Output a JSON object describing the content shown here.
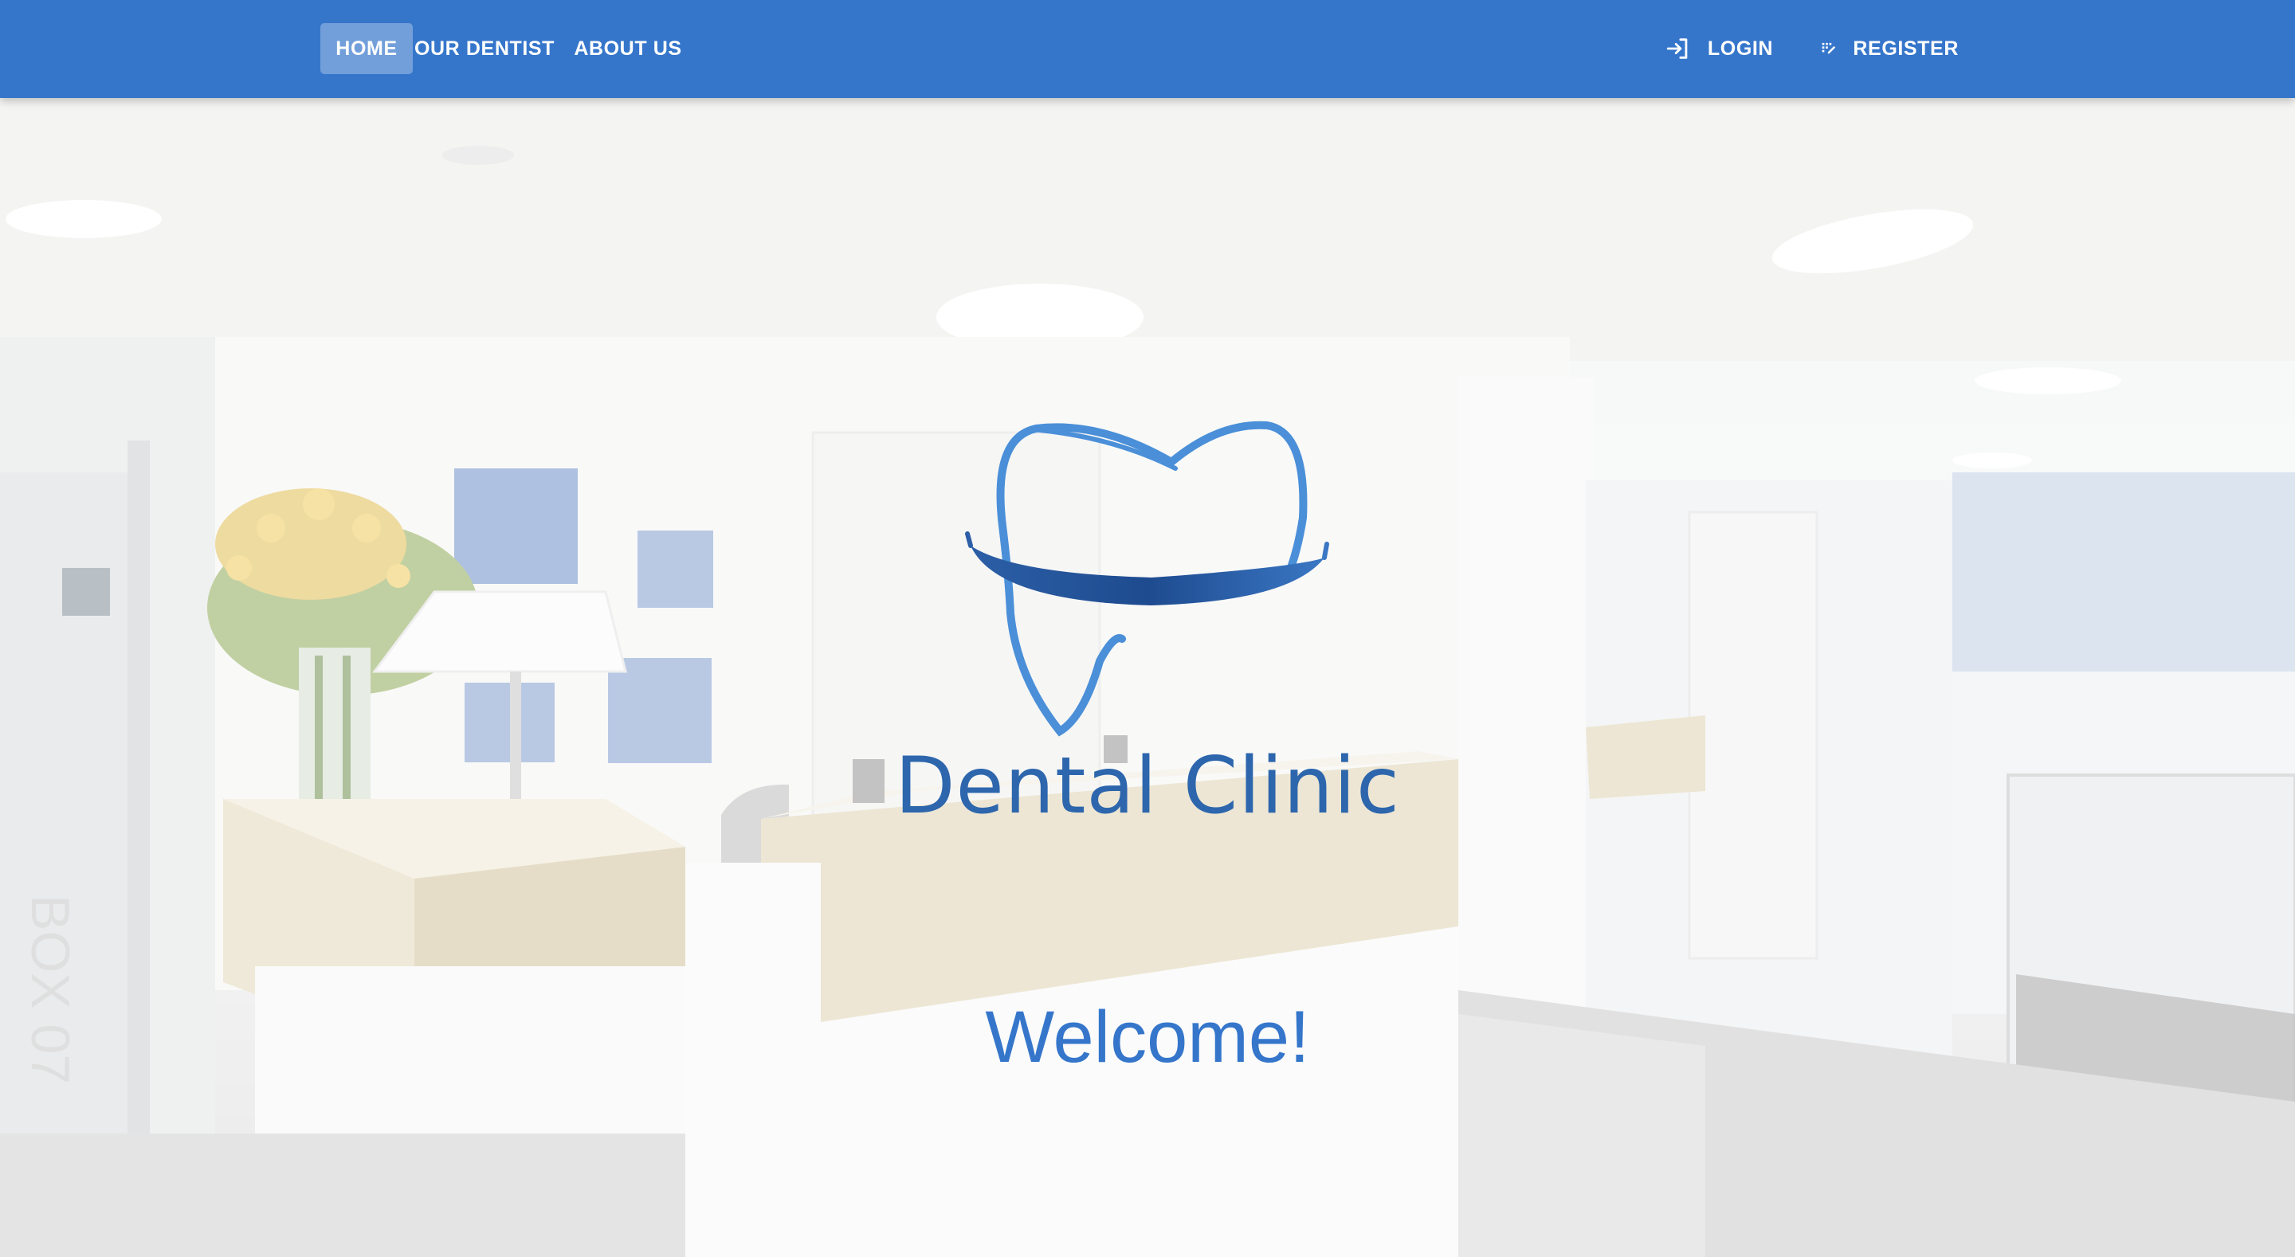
{
  "nav": {
    "home": "HOME",
    "our_dentist": "OUR DENTIST",
    "about_us": "ABOUT US",
    "login": "LOGIN",
    "register": "REGISTER",
    "login_icon": "login-icon",
    "register_icon": "register-icon",
    "active": "home"
  },
  "hero": {
    "brand": "Dental Clinic",
    "welcome": "Welcome!",
    "logo_icon": "tooth-logo-icon",
    "background": "clinic-reception-photo"
  },
  "colors": {
    "appbar": "#3576cb",
    "brand_text": "#2d66ac",
    "welcome_text": "#3576cb"
  }
}
